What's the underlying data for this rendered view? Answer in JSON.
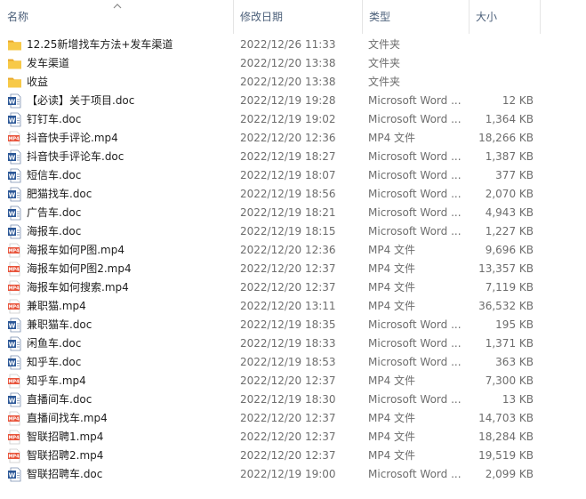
{
  "columns": {
    "name": "名称",
    "date": "修改日期",
    "type": "类型",
    "size": "大小"
  },
  "files": [
    {
      "name": "12.25新增找车方法+发车渠道",
      "date": "2022/12/26 11:33",
      "type": "文件夹",
      "size": "",
      "icon": "folder-icon"
    },
    {
      "name": "发车渠道",
      "date": "2022/12/20 13:38",
      "type": "文件夹",
      "size": "",
      "icon": "folder-icon"
    },
    {
      "name": "收益",
      "date": "2022/12/20 13:38",
      "type": "文件夹",
      "size": "",
      "icon": "folder-icon"
    },
    {
      "name": "【必读】关于项目.doc",
      "date": "2022/12/19 19:28",
      "type": "Microsoft Word ...",
      "size": "12 KB",
      "icon": "word-doc-icon"
    },
    {
      "name": "钉钉车.doc",
      "date": "2022/12/19 19:02",
      "type": "Microsoft Word ...",
      "size": "1,364 KB",
      "icon": "word-doc-icon"
    },
    {
      "name": "抖音快手评论.mp4",
      "date": "2022/12/20 12:36",
      "type": "MP4 文件",
      "size": "18,266 KB",
      "icon": "mp4-file-icon"
    },
    {
      "name": "抖音快手评论车.doc",
      "date": "2022/12/19 18:27",
      "type": "Microsoft Word ...",
      "size": "1,387 KB",
      "icon": "word-doc-icon"
    },
    {
      "name": "短信车.doc",
      "date": "2022/12/19 18:07",
      "type": "Microsoft Word ...",
      "size": "377 KB",
      "icon": "word-doc-icon"
    },
    {
      "name": "肥猫找车.doc",
      "date": "2022/12/19 18:56",
      "type": "Microsoft Word ...",
      "size": "2,070 KB",
      "icon": "word-doc-icon"
    },
    {
      "name": "广告车.doc",
      "date": "2022/12/19 18:21",
      "type": "Microsoft Word ...",
      "size": "4,943 KB",
      "icon": "word-doc-icon"
    },
    {
      "name": "海报车.doc",
      "date": "2022/12/19 18:15",
      "type": "Microsoft Word ...",
      "size": "1,227 KB",
      "icon": "word-doc-icon"
    },
    {
      "name": "海报车如何P图.mp4",
      "date": "2022/12/20 12:36",
      "type": "MP4 文件",
      "size": "9,696 KB",
      "icon": "mp4-file-icon"
    },
    {
      "name": "海报车如何P图2.mp4",
      "date": "2022/12/20 12:37",
      "type": "MP4 文件",
      "size": "13,357 KB",
      "icon": "mp4-file-icon"
    },
    {
      "name": "海报车如何搜索.mp4",
      "date": "2022/12/20 12:37",
      "type": "MP4 文件",
      "size": "7,119 KB",
      "icon": "mp4-file-icon"
    },
    {
      "name": "兼职猫.mp4",
      "date": "2022/12/20 13:11",
      "type": "MP4 文件",
      "size": "36,532 KB",
      "icon": "mp4-file-icon"
    },
    {
      "name": "兼职猫车.doc",
      "date": "2022/12/19 18:35",
      "type": "Microsoft Word ...",
      "size": "195 KB",
      "icon": "word-doc-icon"
    },
    {
      "name": "闲鱼车.doc",
      "date": "2022/12/19 18:33",
      "type": "Microsoft Word ...",
      "size": "1,371 KB",
      "icon": "word-doc-icon"
    },
    {
      "name": "知乎车.doc",
      "date": "2022/12/19 18:53",
      "type": "Microsoft Word ...",
      "size": "363 KB",
      "icon": "word-doc-icon"
    },
    {
      "name": "知乎车.mp4",
      "date": "2022/12/20 12:37",
      "type": "MP4 文件",
      "size": "7,300 KB",
      "icon": "mp4-file-icon"
    },
    {
      "name": "直播间车.doc",
      "date": "2022/12/19 18:30",
      "type": "Microsoft Word ...",
      "size": "13 KB",
      "icon": "word-doc-icon"
    },
    {
      "name": "直播间找车.mp4",
      "date": "2022/12/20 12:37",
      "type": "MP4 文件",
      "size": "14,703 KB",
      "icon": "mp4-file-icon"
    },
    {
      "name": "智联招聘1.mp4",
      "date": "2022/12/20 12:37",
      "type": "MP4 文件",
      "size": "18,284 KB",
      "icon": "mp4-file-icon"
    },
    {
      "name": "智联招聘2.mp4",
      "date": "2022/12/20 12:37",
      "type": "MP4 文件",
      "size": "19,519 KB",
      "icon": "mp4-file-icon"
    },
    {
      "name": "智联招聘车.doc",
      "date": "2022/12/19 19:00",
      "type": "Microsoft Word ...",
      "size": "2,099 KB",
      "icon": "word-doc-icon"
    }
  ],
  "colors": {
    "header_text": "#4c607a",
    "folder": "#f5c04a",
    "word": "#2b5797",
    "mp4": "#e8533a"
  }
}
